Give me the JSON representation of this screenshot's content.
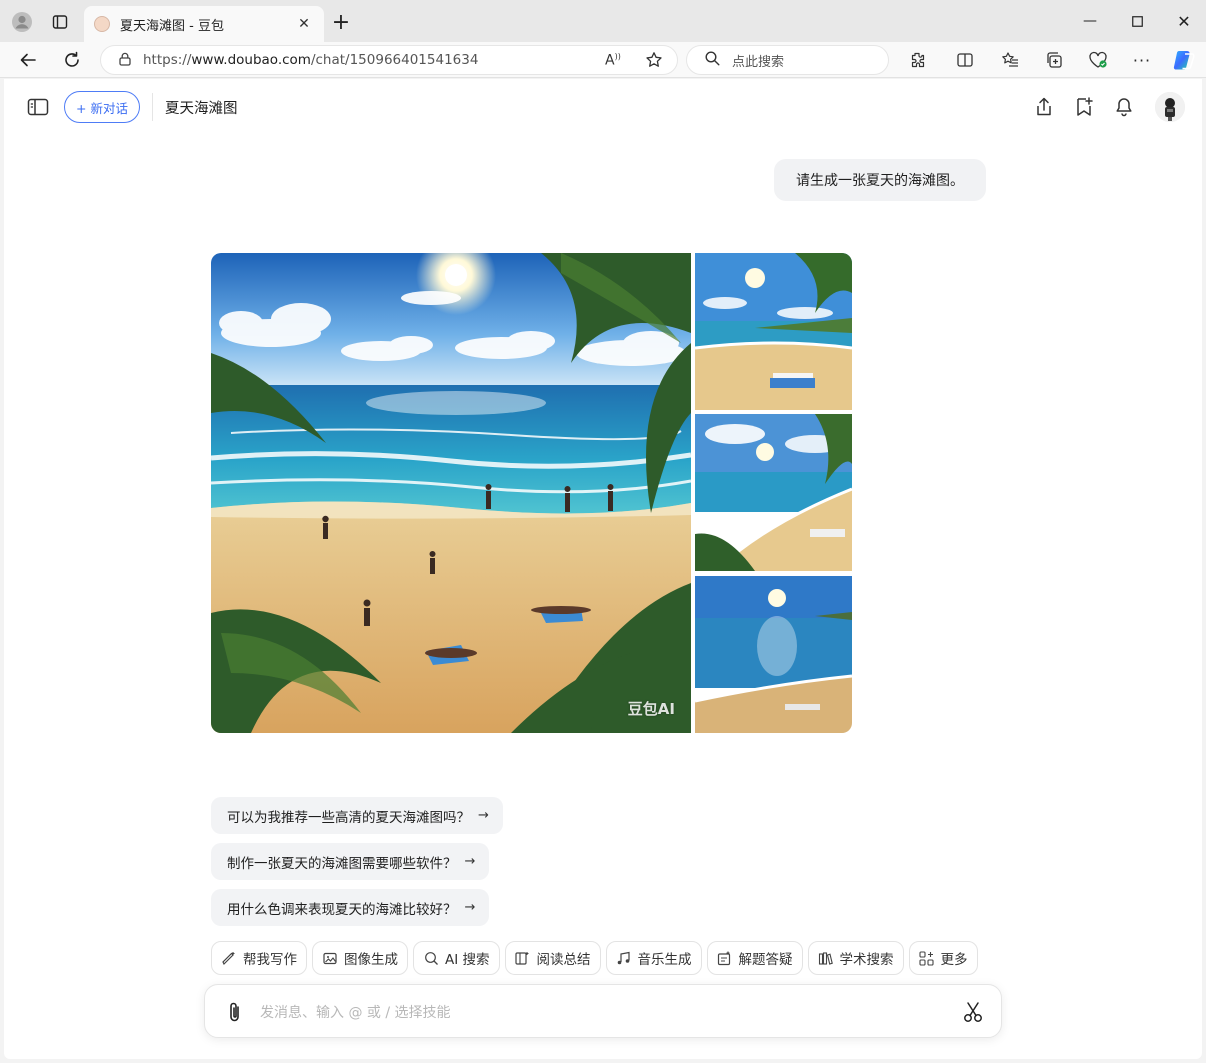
{
  "browser": {
    "tab_title": "夏天海滩图 - 豆包",
    "url_prefix": "https://",
    "url_host": "www.doubao.com",
    "url_path": "/chat/150966401541634",
    "search_placeholder": "点此搜索"
  },
  "header": {
    "new_chat_label": "+ 新对话",
    "chat_title": "夏天海滩图"
  },
  "conversation": {
    "user_message": "请生成一张夏天的海滩图。",
    "watermark": "豆包AI"
  },
  "suggestions": [
    "可以为我推荐一些高清的夏天海滩图吗？",
    "制作一张夏天的海滩图需要哪些软件？",
    "用什么色调来表现夏天的海滩比较好？"
  ],
  "skills": [
    {
      "label": "帮我写作",
      "icon": "pen-icon"
    },
    {
      "label": "图像生成",
      "icon": "image-icon"
    },
    {
      "label": "AI 搜索",
      "icon": "search-icon"
    },
    {
      "label": "阅读总结",
      "icon": "read-icon"
    },
    {
      "label": "音乐生成",
      "icon": "music-icon"
    },
    {
      "label": "解题答疑",
      "icon": "solve-icon"
    },
    {
      "label": "学术搜索",
      "icon": "academic-icon"
    },
    {
      "label": "更多",
      "icon": "grid-icon"
    }
  ],
  "composer": {
    "placeholder": "发消息、输入 @ 或 / 选择技能"
  }
}
